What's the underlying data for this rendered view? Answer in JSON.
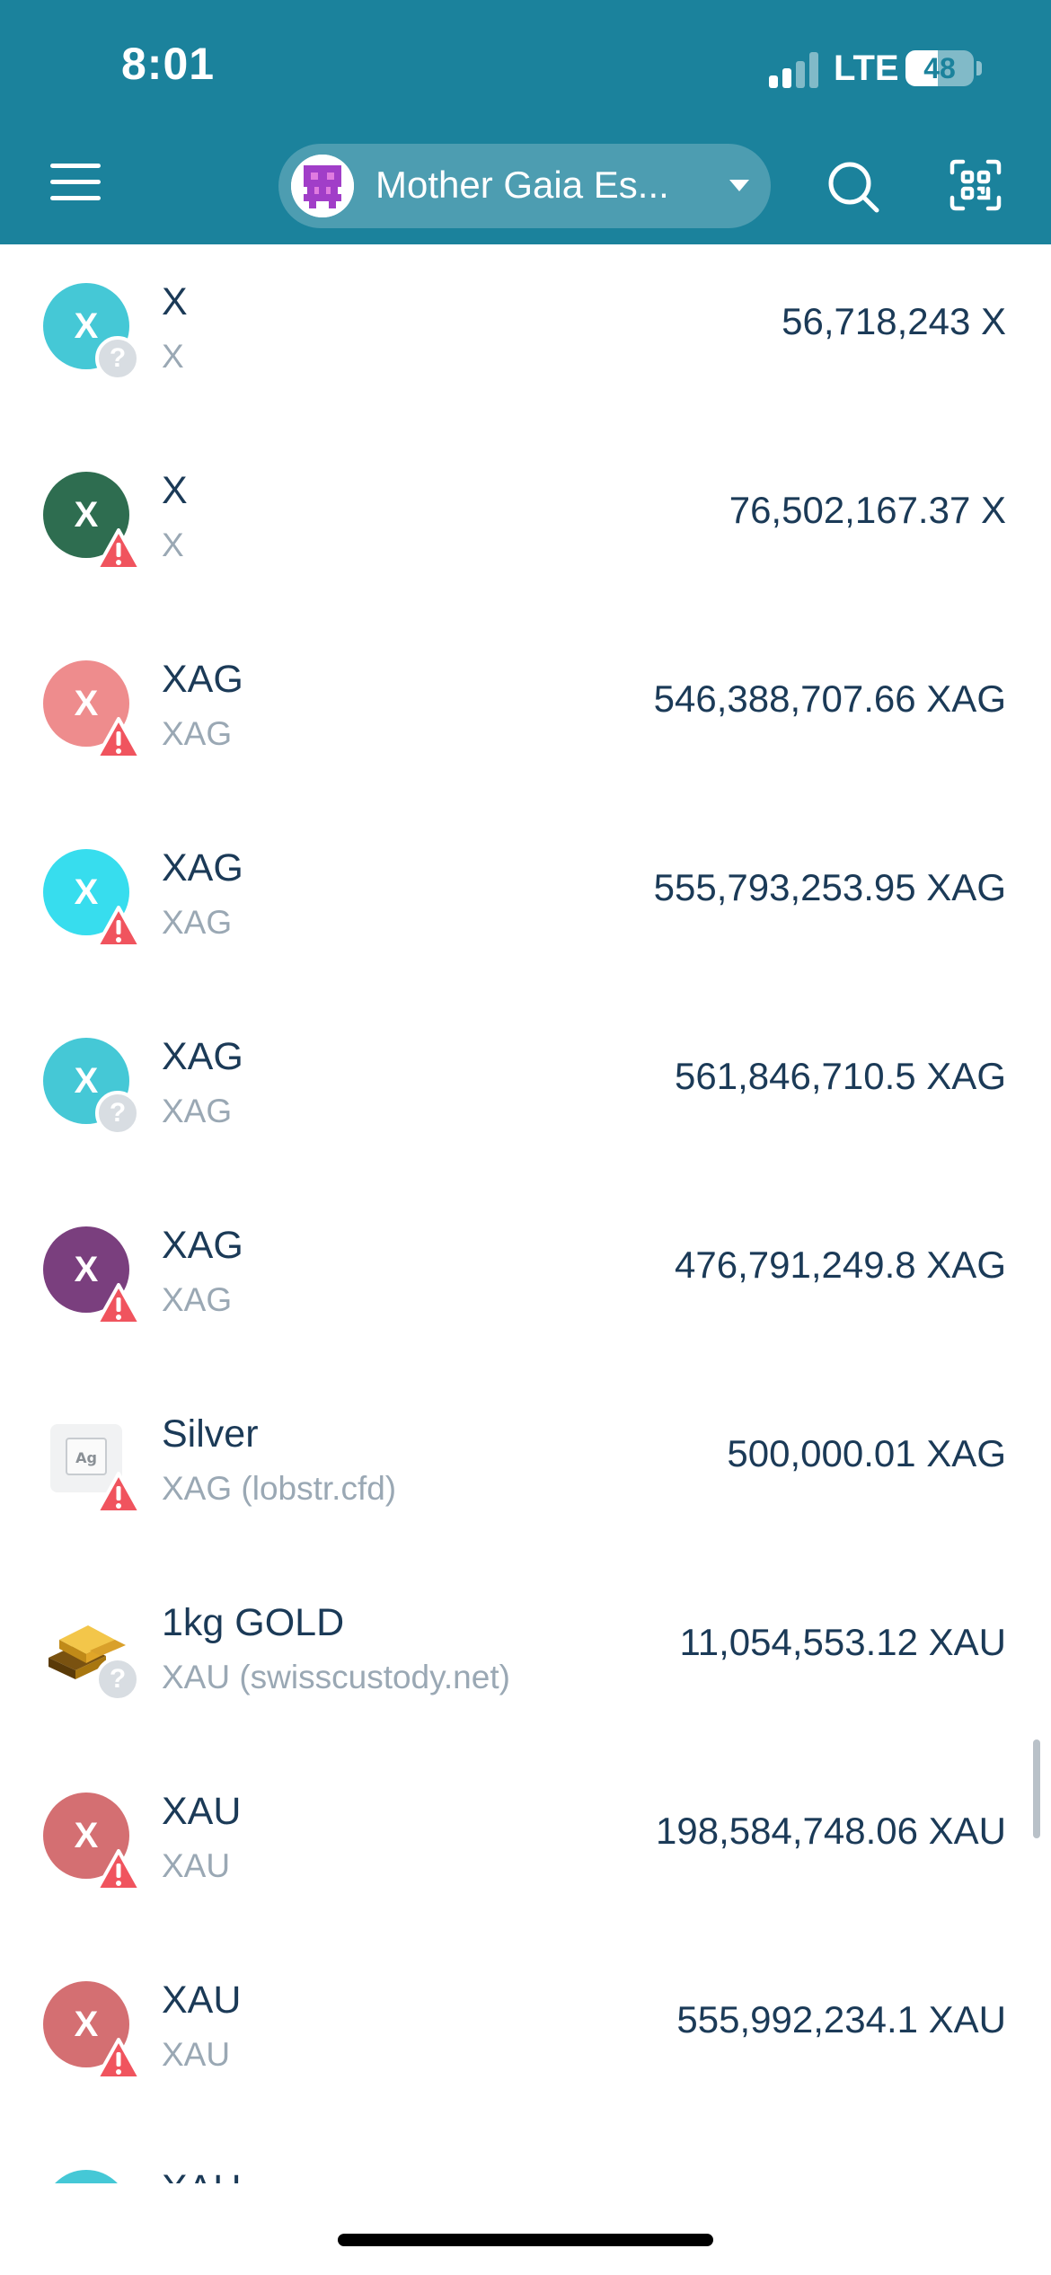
{
  "status_bar": {
    "time": "8:01",
    "network": "LTE",
    "battery": "48",
    "battery_level": 0.48
  },
  "header": {
    "account_name": "Mother Gaia Es...",
    "icons": [
      "menu-icon",
      "search-icon",
      "qr-scan-icon",
      "chevron-down-icon"
    ],
    "background_color": "#1b829c"
  },
  "assets": [
    {
      "name": "X",
      "code": "X",
      "balance": "56,718,243 X",
      "avatar_letter": "X",
      "avatar_color": "#45c8d6",
      "badge": "unknown"
    },
    {
      "name": "X",
      "code": "X",
      "balance": "76,502,167.37 X",
      "avatar_letter": "X",
      "avatar_color": "#2e6d50",
      "badge": "warning"
    },
    {
      "name": "XAG",
      "code": "XAG",
      "balance": "546,388,707.66 XAG",
      "avatar_letter": "X",
      "avatar_color": "#ee8c8d",
      "badge": "warning"
    },
    {
      "name": "XAG",
      "code": "XAG",
      "balance": "555,793,253.95 XAG",
      "avatar_letter": "X",
      "avatar_color": "#37ddee",
      "badge": "warning"
    },
    {
      "name": "XAG",
      "code": "XAG",
      "balance": "561,846,710.5 XAG",
      "avatar_letter": "X",
      "avatar_color": "#45c8d6",
      "badge": "unknown"
    },
    {
      "name": "XAG",
      "code": "XAG",
      "balance": "476,791,249.8 XAG",
      "avatar_letter": "X",
      "avatar_color": "#7a3f7e",
      "badge": "warning"
    },
    {
      "name": "Silver",
      "code": "XAG (lobstr.cfd)",
      "balance": "500,000.01 XAG",
      "avatar_letter": "Ag",
      "avatar_color": "#f1f2f3",
      "badge": "warning",
      "image": "silver"
    },
    {
      "name": "1kg GOLD",
      "code": "XAU (swisscustody.net)",
      "balance": "11,054,553.12 XAU",
      "avatar_letter": "",
      "avatar_color": "#c99a2e",
      "badge": "unknown",
      "image": "gold"
    },
    {
      "name": "XAU",
      "code": "XAU",
      "balance": "198,584,748.06 XAU",
      "avatar_letter": "X",
      "avatar_color": "#d46f72",
      "badge": "warning"
    },
    {
      "name": "XAU",
      "code": "XAU",
      "balance": "555,992,234.1 XAU",
      "avatar_letter": "X",
      "avatar_color": "#d46f72",
      "badge": "warning"
    },
    {
      "name": "XAU",
      "code": "",
      "balance": "",
      "avatar_letter": "",
      "avatar_color": "#45c8d6",
      "badge": "none"
    }
  ],
  "colors": {
    "warning": "#f0545e",
    "text_primary": "#1b3a57",
    "text_secondary": "#9aa8b4"
  }
}
